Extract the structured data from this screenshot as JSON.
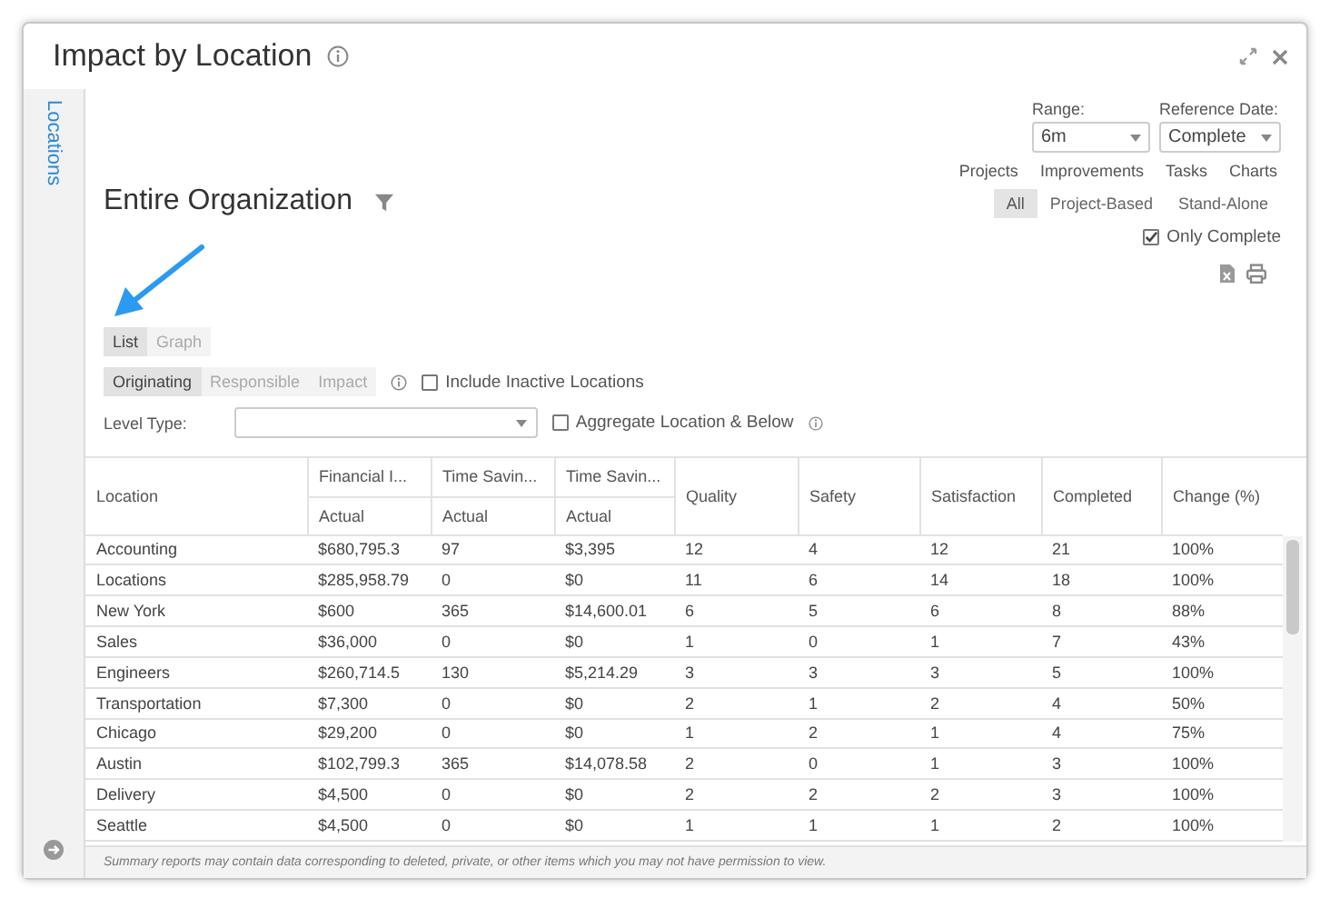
{
  "window": {
    "title": "Impact by Location"
  },
  "sidebar": {
    "tab": "Locations"
  },
  "heading": "Entire Organization",
  "range": {
    "label": "Range:",
    "value": "6m"
  },
  "reference_date": {
    "label": "Reference Date:",
    "value": "Complete"
  },
  "type_links": [
    "Projects",
    "Improvements",
    "Tasks",
    "Charts"
  ],
  "scope_segments": [
    {
      "label": "All",
      "selected": true
    },
    {
      "label": "Project-Based",
      "selected": false
    },
    {
      "label": "Stand-Alone",
      "selected": false
    }
  ],
  "only_complete": {
    "label": "Only Complete",
    "checked": true
  },
  "view_tabs": [
    {
      "label": "List",
      "selected": true
    },
    {
      "label": "Graph",
      "selected": false
    }
  ],
  "perspective_tabs": [
    {
      "label": "Originating",
      "selected": true
    },
    {
      "label": "Responsible",
      "selected": false
    },
    {
      "label": "Impact",
      "selected": false
    }
  ],
  "include_inactive": {
    "label": "Include Inactive Locations",
    "checked": false
  },
  "level_type": {
    "label": "Level Type:"
  },
  "aggregate": {
    "label": "Aggregate Location & Below",
    "checked": false
  },
  "table": {
    "columns": [
      {
        "label": "Location"
      },
      {
        "label": "Financial I...",
        "sublabel": "Actual"
      },
      {
        "label": "Time Savin...",
        "sublabel": "Actual"
      },
      {
        "label": "Time Savin...",
        "sublabel": "Actual"
      },
      {
        "label": "Quality"
      },
      {
        "label": "Safety"
      },
      {
        "label": "Satisfaction"
      },
      {
        "label": "Completed"
      },
      {
        "label": "Change (%)"
      }
    ],
    "rows": [
      [
        "Accounting",
        "$680,795.3",
        "97",
        "$3,395",
        "12",
        "4",
        "12",
        "21",
        "100%"
      ],
      [
        "Locations",
        "$285,958.79",
        "0",
        "$0",
        "11",
        "6",
        "14",
        "18",
        "100%"
      ],
      [
        "New York",
        "$600",
        "365",
        "$14,600.01",
        "6",
        "5",
        "6",
        "8",
        "88%"
      ],
      [
        "Sales",
        "$36,000",
        "0",
        "$0",
        "1",
        "0",
        "1",
        "7",
        "43%"
      ],
      [
        "Engineers",
        "$260,714.5",
        "130",
        "$5,214.29",
        "3",
        "3",
        "3",
        "5",
        "100%"
      ],
      [
        "Transportation",
        "$7,300",
        "0",
        "$0",
        "2",
        "1",
        "2",
        "4",
        "50%"
      ],
      [
        "Chicago",
        "$29,200",
        "0",
        "$0",
        "1",
        "2",
        "1",
        "4",
        "75%"
      ],
      [
        "Austin",
        "$102,799.3",
        "365",
        "$14,078.58",
        "2",
        "0",
        "1",
        "3",
        "100%"
      ],
      [
        "Delivery",
        "$4,500",
        "0",
        "$0",
        "2",
        "2",
        "2",
        "3",
        "100%"
      ],
      [
        "Seattle",
        "$4,500",
        "0",
        "$0",
        "1",
        "1",
        "1",
        "2",
        "100%"
      ]
    ]
  },
  "footnote": "Summary reports may contain data corresponding to deleted, private, or other items which you may not have permission to view."
}
